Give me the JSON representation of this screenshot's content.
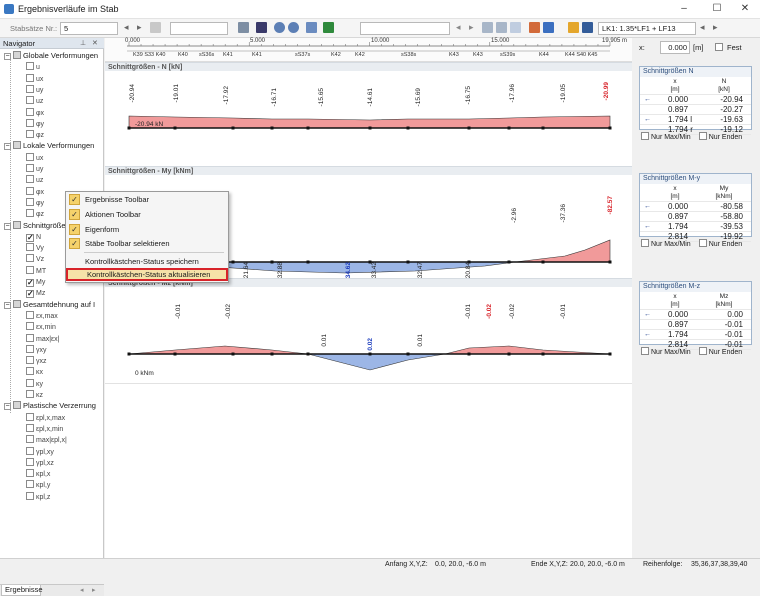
{
  "window": {
    "title": "Ergebnisverläufe im Stab",
    "minimize": "–",
    "maximize": "☐",
    "close": "✕"
  },
  "toolbar": {
    "stabsaetze_label": "Stabsätze Nr.:",
    "stabsaetze_value": "5",
    "lk_value": "LK1: 1.35*LF1 + LF13",
    "x_label": "x:",
    "x_value": "0.000",
    "x_unit": "[m]",
    "fest_label": "Fest"
  },
  "navigator": {
    "title": "Navigator",
    "tab": "Ergebnisse",
    "groups": [
      {
        "label": "Globale Verformungen",
        "items": [
          "u",
          "ux",
          "uy",
          "uz",
          "φx",
          "φy",
          "φz"
        ]
      },
      {
        "label": "Lokale Verformungen",
        "items": [
          "ux",
          "uy",
          "uz",
          "φx",
          "φy",
          "φz"
        ]
      },
      {
        "label": "Schnittgrößen",
        "items": [
          "N",
          "Vy",
          "Vz",
          "MT",
          "My",
          "Mz"
        ],
        "checked": [
          true,
          false,
          false,
          false,
          true,
          true
        ]
      },
      {
        "label": "Gesamtdehnung auf I",
        "items": [
          "εx,max",
          "εx,min",
          "max|εx|",
          "γxy",
          "γxz",
          "κx",
          "κy",
          "κz"
        ]
      },
      {
        "label": "Plastische Verzerrung",
        "items": [
          "εpl,x,max",
          "εpl,x,min",
          "max|εpl,x|",
          "γpl,xy",
          "γpl,xz",
          "κpl,x",
          "κpl,y",
          "κpl,z"
        ]
      }
    ]
  },
  "ruler": {
    "ticks": [
      "0.000",
      "5.000",
      "10.000",
      "15.000",
      "19.905 m"
    ],
    "stations": [
      "K39 S33 K40",
      "K40",
      "sS36s",
      "K41",
      "K41",
      "sS37s",
      "K42",
      "K42",
      "sS38s",
      "K43",
      "K43",
      "sS39s",
      "K44",
      "K44 S40 K45"
    ]
  },
  "plots": [
    {
      "title": "Schnittgrößen - N [kN]",
      "start_label": "-20.94 kN",
      "labels": [
        "-20.94",
        "-19.01",
        "-17.92",
        "-16.71",
        "-15.65",
        "-14.61",
        "-15.69",
        "-16.75",
        "-17.96",
        "-19.05",
        "-20.99"
      ]
    },
    {
      "title": "Schnittgrößen - My [kNm]",
      "labels": [
        "21.64",
        "32.88",
        "34.62",
        "33.42",
        "32.47",
        "20.84",
        "-2.96",
        "-37.36",
        "-82.57"
      ]
    },
    {
      "title": "Schnittgrößen - Mz [kNm]",
      "start_label": "0 kNm",
      "labels": [
        "-0.01",
        "-0.02",
        "0.01",
        "0.02",
        "0.01",
        "-0.01",
        "-0.02",
        "-0.02",
        "-0.01"
      ]
    }
  ],
  "tables": [
    {
      "title": "Schnittgrößen N",
      "h1": "x",
      "h1u": "[m]",
      "h2": "N",
      "h2u": "[kN]",
      "rows": [
        [
          "0.000",
          "-20.94"
        ],
        [
          "0.897",
          "-20.27"
        ],
        [
          "1.794 l",
          "-19.63"
        ],
        [
          "1.794 r",
          "-19.12"
        ]
      ],
      "opt1": "Nur Max/Min",
      "opt2": "Nur Enden"
    },
    {
      "title": "Schnittgrößen M-y",
      "h1": "x",
      "h1u": "[m]",
      "h2": "My",
      "h2u": "[kNm]",
      "rows": [
        [
          "0.000",
          "-80.58"
        ],
        [
          "0.897",
          "-58.80"
        ],
        [
          "1.794",
          "-39.53"
        ],
        [
          "2.814",
          "-19.92"
        ]
      ],
      "opt1": "Nur Max/Min",
      "opt2": "Nur Enden"
    },
    {
      "title": "Schnittgrößen M-z",
      "h1": "x",
      "h1u": "[m]",
      "h2": "Mz",
      "h2u": "[kNm]",
      "rows": [
        [
          "0.000",
          "0.00"
        ],
        [
          "0.897",
          "-0.01"
        ],
        [
          "1.794",
          "-0.01"
        ],
        [
          "2.814",
          "-0.01"
        ]
      ],
      "opt1": "Nur Max/Min",
      "opt2": "Nur Enden"
    }
  ],
  "context_menu": {
    "items": [
      {
        "label": "Ergebnisse Toolbar",
        "checked": true
      },
      {
        "label": "Aktionen Toolbar",
        "checked": true
      },
      {
        "label": "Eigenform",
        "checked": true
      },
      {
        "label": "Stäbe Toolbar selektieren",
        "checked": true
      },
      {
        "label": "Kontrollkästchen-Status speichern",
        "checked": false
      },
      {
        "label": "Kontrollkästchen-Status aktualisieren",
        "checked": false
      }
    ]
  },
  "status": {
    "anfang_label": "Anfang X,Y,Z:",
    "anfang_value": "0.0, 20.0, -6.0 m",
    "ende_label": "Ende X,Y,Z:",
    "ende_value": "20.0, 20.0, -6.0 m",
    "reihenfolge_label": "Reihenfolge:",
    "reihenfolge_value": "35,36,37,38,39,40"
  },
  "colors": {
    "positive_fill": "#f19a9a",
    "negative_fill": "#9cb6e6",
    "highlight_red": "#d8232a",
    "highlight_blue": "#1f3fbf",
    "menu_highlight_border": "#d8232a"
  }
}
